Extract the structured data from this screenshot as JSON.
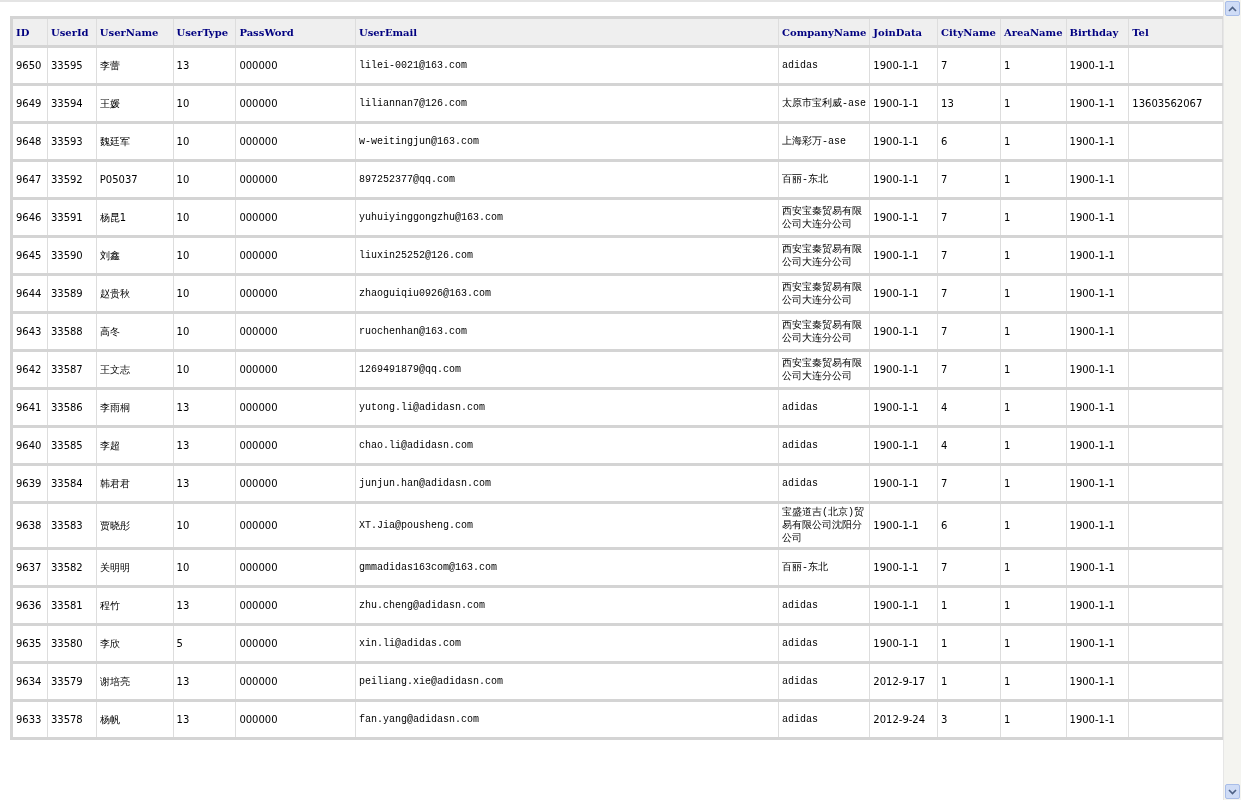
{
  "table": {
    "columns": [
      "ID",
      "UserId",
      "UserName",
      "UserType",
      "PassWord",
      "UserEmail",
      "CompanyName",
      "JoinData",
      "CityName",
      "AreaName",
      "Birthday",
      "Tel"
    ],
    "rows": [
      [
        "9650",
        "33595",
        "李蕾",
        "13",
        "000000",
        "lilei-0021@163.com",
        "adidas",
        "1900-1-1",
        "7",
        "1",
        "1900-1-1",
        ""
      ],
      [
        "9649",
        "33594",
        "王媛",
        "10",
        "000000",
        "liliannan7@126.com",
        "太原市宝利威-ase",
        "1900-1-1",
        "13",
        "1",
        "1900-1-1",
        "13603562067"
      ],
      [
        "9648",
        "33593",
        "魏廷军",
        "10",
        "000000",
        "w-weitingjun@163.com",
        "上海彩万-ase",
        "1900-1-1",
        "6",
        "1",
        "1900-1-1",
        ""
      ],
      [
        "9647",
        "33592",
        "P05037",
        "10",
        "000000",
        "897252377@qq.com",
        "百丽-东北",
        "1900-1-1",
        "7",
        "1",
        "1900-1-1",
        ""
      ],
      [
        "9646",
        "33591",
        "杨昆1",
        "10",
        "000000",
        "yuhuiyinggongzhu@163.com",
        "西安宝秦贸易有限公司大连分公司",
        "1900-1-1",
        "7",
        "1",
        "1900-1-1",
        ""
      ],
      [
        "9645",
        "33590",
        "刘鑫",
        "10",
        "000000",
        "liuxin25252@126.com",
        "西安宝秦贸易有限公司大连分公司",
        "1900-1-1",
        "7",
        "1",
        "1900-1-1",
        ""
      ],
      [
        "9644",
        "33589",
        "赵贵秋",
        "10",
        "000000",
        "zhaoguiqiu0926@163.com",
        "西安宝秦贸易有限公司大连分公司",
        "1900-1-1",
        "7",
        "1",
        "1900-1-1",
        ""
      ],
      [
        "9643",
        "33588",
        "高冬",
        "10",
        "000000",
        "ruochenhan@163.com",
        "西安宝秦贸易有限公司大连分公司",
        "1900-1-1",
        "7",
        "1",
        "1900-1-1",
        ""
      ],
      [
        "9642",
        "33587",
        "王文志",
        "10",
        "000000",
        "1269491879@qq.com",
        "西安宝秦贸易有限公司大连分公司",
        "1900-1-1",
        "7",
        "1",
        "1900-1-1",
        ""
      ],
      [
        "9641",
        "33586",
        "李雨桐",
        "13",
        "000000",
        "yutong.li@adidasn.com",
        "adidas",
        "1900-1-1",
        "4",
        "1",
        "1900-1-1",
        ""
      ],
      [
        "9640",
        "33585",
        "李超",
        "13",
        "000000",
        "chao.li@adidasn.com",
        "adidas",
        "1900-1-1",
        "4",
        "1",
        "1900-1-1",
        ""
      ],
      [
        "9639",
        "33584",
        "韩君君",
        "13",
        "000000",
        "junjun.han@adidasn.com",
        "adidas",
        "1900-1-1",
        "7",
        "1",
        "1900-1-1",
        ""
      ],
      [
        "9638",
        "33583",
        "贾晓彤",
        "10",
        "000000",
        "XT.Jia@pousheng.com",
        "宝盛道吉(北京)贸易有限公司沈阳分公司",
        "1900-1-1",
        "6",
        "1",
        "1900-1-1",
        ""
      ],
      [
        "9637",
        "33582",
        "关明明",
        "10",
        "000000",
        "gmmadidas163com@163.com",
        "百丽-东北",
        "1900-1-1",
        "7",
        "1",
        "1900-1-1",
        ""
      ],
      [
        "9636",
        "33581",
        "程竹",
        "13",
        "000000",
        "zhu.cheng@adidasn.com",
        "adidas",
        "1900-1-1",
        "1",
        "1",
        "1900-1-1",
        ""
      ],
      [
        "9635",
        "33580",
        "李欣",
        "5",
        "000000",
        "xin.li@adidas.com",
        "adidas",
        "1900-1-1",
        "1",
        "1",
        "1900-1-1",
        ""
      ],
      [
        "9634",
        "33579",
        "谢培亮",
        "13",
        "000000",
        "peiliang.xie@adidasn.com",
        "adidas",
        "2012-9-17",
        "1",
        "1",
        "1900-1-1",
        ""
      ],
      [
        "9633",
        "33578",
        "杨帆",
        "13",
        "000000",
        "fan.yang@adidasn.com",
        "adidas",
        "2012-9-24",
        "3",
        "1",
        "1900-1-1",
        ""
      ]
    ]
  }
}
